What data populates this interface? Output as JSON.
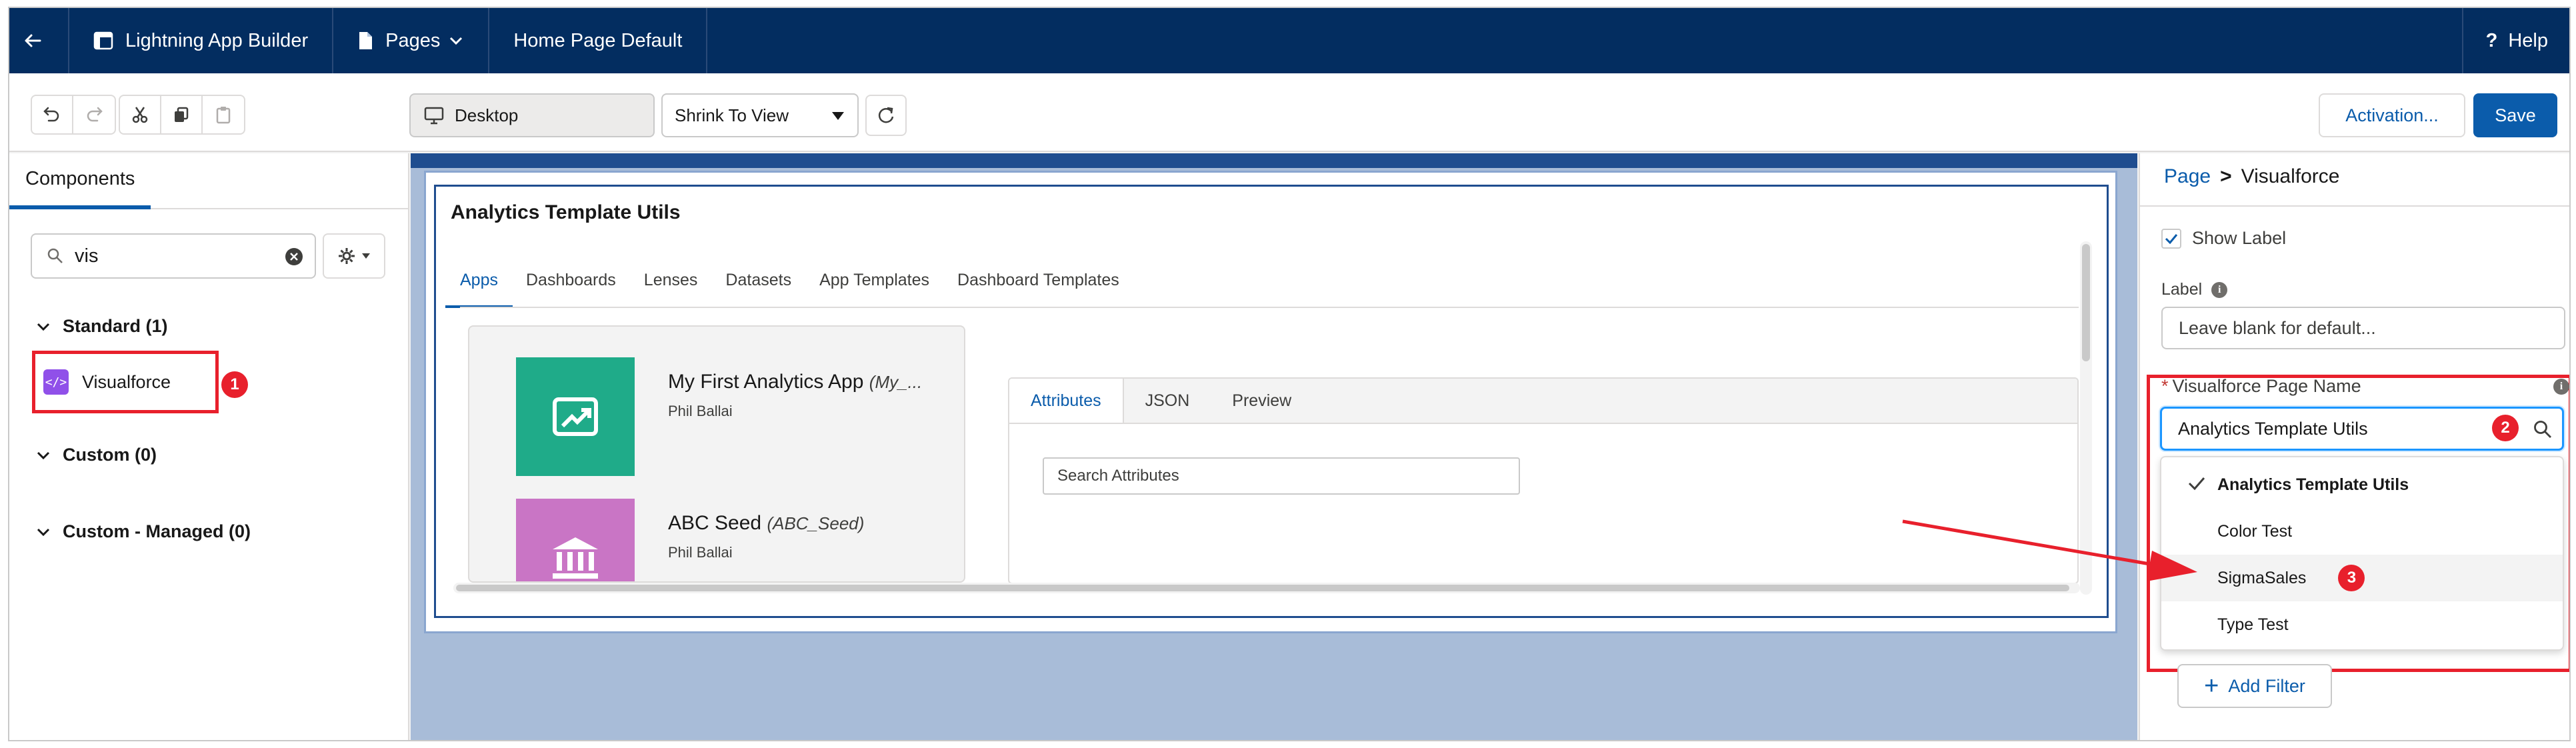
{
  "topnav": {
    "app_builder": "Lightning App Builder",
    "pages": "Pages",
    "page_title": "Home Page Default",
    "help": "Help"
  },
  "toolbar": {
    "device": "Desktop",
    "view_mode": "Shrink To View",
    "activation": "Activation...",
    "save": "Save"
  },
  "left_panel": {
    "tab": "Components",
    "search_value": "vis",
    "sections": {
      "standard": "Standard (1)",
      "custom": "Custom (0)",
      "custom_managed": "Custom - Managed (0)"
    },
    "component": "Visualforce"
  },
  "canvas": {
    "card_title": "Analytics Template Utils",
    "tabs": [
      "Apps",
      "Dashboards",
      "Lenses",
      "Datasets",
      "App Templates",
      "Dashboard Templates"
    ],
    "apps": [
      {
        "name": "My First Analytics App",
        "api": "(My_...",
        "owner": "Phil Ballai",
        "color": "#1fab89"
      },
      {
        "name": "ABC Seed",
        "api": "(ABC_Seed)",
        "owner": "Phil Ballai",
        "color": "#c975c5"
      }
    ],
    "attr_tabs": [
      "Attributes",
      "JSON",
      "Preview"
    ],
    "attr_search_placeholder": "Search Attributes"
  },
  "right_panel": {
    "breadcrumb": {
      "root": "Page",
      "sep": ">",
      "current": "Visualforce"
    },
    "show_label": "Show Label",
    "label_field": "Label",
    "label_placeholder": "Leave blank for default...",
    "vf_field_label": "Visualforce Page Name",
    "vf_required": "*",
    "vf_value": "Analytics Template Utils",
    "options": [
      "Analytics Template Utils",
      "Color Test",
      "SigmaSales",
      "Type Test"
    ],
    "selected_option": "Analytics Template Utils",
    "add_filter": "Add Filter"
  },
  "annotations": {
    "marker1": "1",
    "marker2": "2",
    "marker3": "3",
    "color": "#e8202c"
  },
  "colors": {
    "nav": "#032d60",
    "brand": "#0b5cab",
    "focus": "#1b96ff"
  }
}
